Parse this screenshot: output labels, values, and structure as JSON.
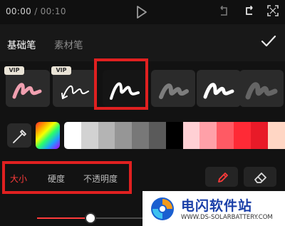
{
  "player": {
    "current_time": "00:00",
    "separator": " / ",
    "duration": "00:10",
    "icons": [
      "play-icon",
      "undo-icon",
      "redo-icon",
      "fullscreen-icon"
    ]
  },
  "tabs": [
    {
      "label": "基础笔",
      "active": true
    },
    {
      "label": "素材笔",
      "active": false
    }
  ],
  "confirm_icon": "checkmark-icon",
  "brushes": [
    {
      "name": "pink-marker",
      "vip": "VIP",
      "color": "#f0a0b0"
    },
    {
      "name": "arrow-pen",
      "vip": "VIP",
      "color": "#ffffff"
    },
    {
      "name": "solid-pen",
      "vip": "",
      "color": "#ffffff",
      "selected": true
    },
    {
      "name": "soft-gray",
      "vip": "",
      "color": "#9a9a9a"
    },
    {
      "name": "bold-white",
      "vip": "",
      "color": "#ffffff"
    },
    {
      "name": "blur-gray",
      "vip": "",
      "color": "#8c8c8c"
    }
  ],
  "colors": [
    "#ffffff",
    "#d2d2d2",
    "#b4b4b4",
    "#969696",
    "#787878",
    "#5a5a5a",
    "#000000",
    "#ffd0d4",
    "#ffa0a8",
    "#ff5a64",
    "#ff2a36",
    "#e81a28",
    "#ffd6c4"
  ],
  "properties": [
    {
      "label": "大小",
      "selected": true
    },
    {
      "label": "硬度",
      "selected": false
    },
    {
      "label": "不透明度",
      "selected": false
    }
  ],
  "tools": [
    "pen-icon",
    "eraser-icon"
  ],
  "accent": "#ff3b3b",
  "size_slider": {
    "value": 0.25
  },
  "watermark": {
    "title": "电闪软件站",
    "url": "WWW.DS-SOLARBATTERY.COM"
  }
}
